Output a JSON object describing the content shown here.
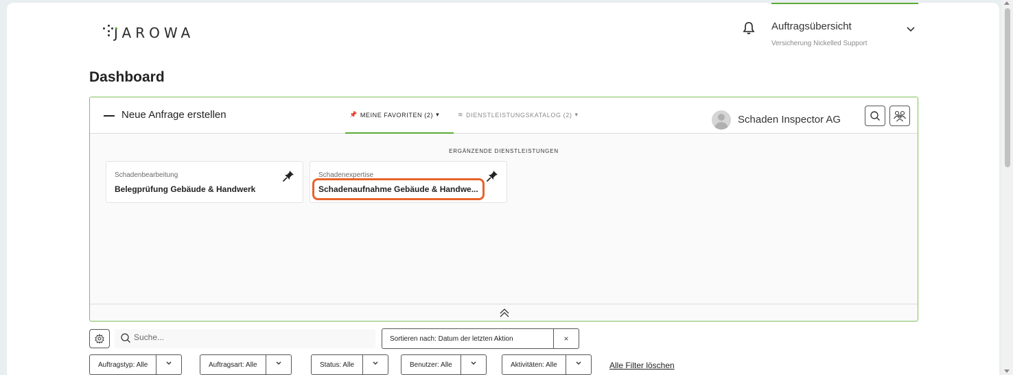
{
  "brand": {
    "logo_text": "JAROWA"
  },
  "account": {
    "title": "Auftragsübersicht",
    "subtitle": "Versicherung Nickelled Support"
  },
  "page": {
    "title": "Dashboard"
  },
  "panel": {
    "title": "Neue Anfrage erstellen",
    "tabs": [
      {
        "label": "MEINE FAVORITEN (2)",
        "active": true
      },
      {
        "label": "DIENSTLEISTUNGSKATALOG (2)",
        "active": false
      }
    ],
    "user": {
      "name": "Schaden Inspector AG"
    },
    "section_label": "ERGÄNZENDE DIENSTLEISTUNGEN",
    "cards": [
      {
        "category": "Schadenbearbeitung",
        "name": "Belegprüfung Gebäude & Handwerk",
        "pinned": true
      },
      {
        "category": "Schadenexpertise",
        "name": "Schadenaufnahme Gebäude & Handwe...",
        "pinned": true,
        "highlighted": true
      }
    ]
  },
  "toolbar": {
    "search_placeholder": "Suche...",
    "sort_label": "Sortieren nach: Datum der letzten Aktion",
    "sort_clear": "×"
  },
  "filters": [
    {
      "label": "Auftragstyp: Alle"
    },
    {
      "label": "Auftragsart: Alle"
    },
    {
      "label": "Status: Alle"
    },
    {
      "label": "Benutzer: Alle"
    },
    {
      "label": "Aktivitäten: Alle"
    }
  ],
  "clear_filters_label": "Alle Filter löschen",
  "colors": {
    "accent_green": "#5aaa35",
    "highlight_orange": "#e8622a"
  }
}
